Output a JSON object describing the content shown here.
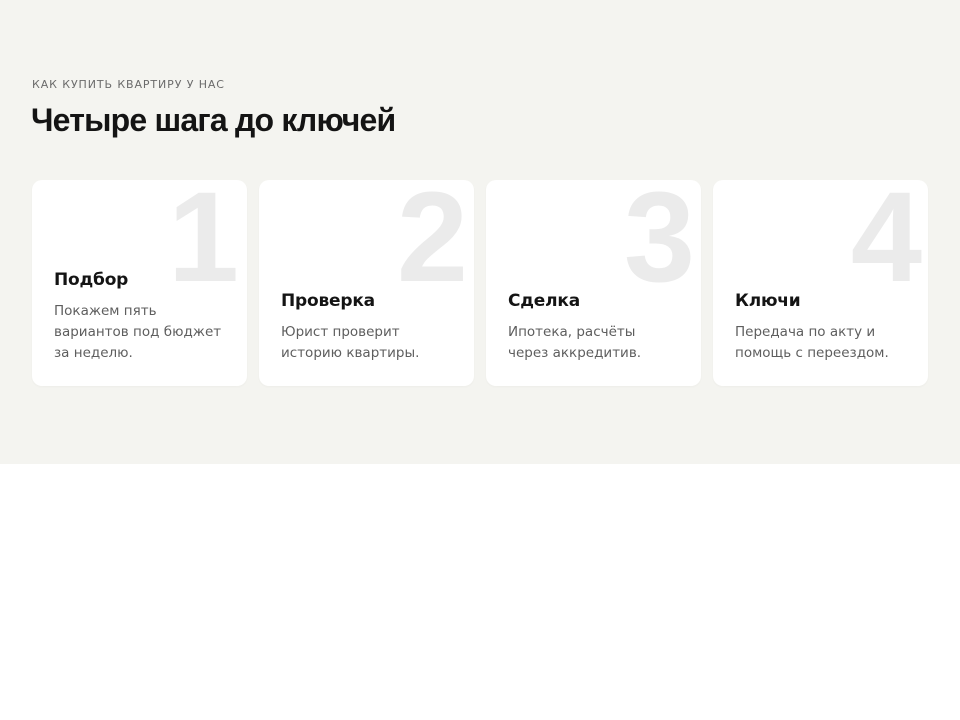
{
  "section": {
    "eyebrow": "КАК КУПИТЬ КВАРТИРУ У НАС",
    "headline": "Четыре шага до ключей"
  },
  "steps": [
    {
      "number": "1",
      "title": "Подбор",
      "text": "Покажем пять вариантов под бюджет за неделю."
    },
    {
      "number": "2",
      "title": "Проверка",
      "text": "Юрист проверит историю квартиры."
    },
    {
      "number": "3",
      "title": "Сделка",
      "text": "Ипотека, расчёты через аккредитив."
    },
    {
      "number": "4",
      "title": "Ключи",
      "text": "Передача по акту и помощь с переездом."
    }
  ],
  "colors": {
    "section_background": "#f4f4f0",
    "card_background": "#ffffff",
    "step_number": "#ebebeb",
    "headline": "#141414",
    "body_text": "#5e5e5e"
  }
}
